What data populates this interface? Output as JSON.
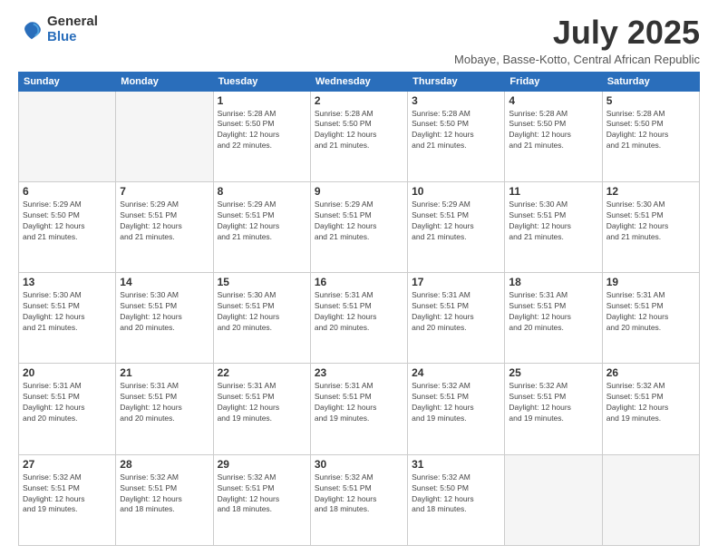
{
  "logo": {
    "general": "General",
    "blue": "Blue"
  },
  "title": "July 2025",
  "location": "Mobaye, Basse-Kotto, Central African Republic",
  "days_of_week": [
    "Sunday",
    "Monday",
    "Tuesday",
    "Wednesday",
    "Thursday",
    "Friday",
    "Saturday"
  ],
  "weeks": [
    [
      {
        "day": "",
        "info": ""
      },
      {
        "day": "",
        "info": ""
      },
      {
        "day": "1",
        "info": "Sunrise: 5:28 AM\nSunset: 5:50 PM\nDaylight: 12 hours\nand 22 minutes."
      },
      {
        "day": "2",
        "info": "Sunrise: 5:28 AM\nSunset: 5:50 PM\nDaylight: 12 hours\nand 21 minutes."
      },
      {
        "day": "3",
        "info": "Sunrise: 5:28 AM\nSunset: 5:50 PM\nDaylight: 12 hours\nand 21 minutes."
      },
      {
        "day": "4",
        "info": "Sunrise: 5:28 AM\nSunset: 5:50 PM\nDaylight: 12 hours\nand 21 minutes."
      },
      {
        "day": "5",
        "info": "Sunrise: 5:28 AM\nSunset: 5:50 PM\nDaylight: 12 hours\nand 21 minutes."
      }
    ],
    [
      {
        "day": "6",
        "info": "Sunrise: 5:29 AM\nSunset: 5:50 PM\nDaylight: 12 hours\nand 21 minutes."
      },
      {
        "day": "7",
        "info": "Sunrise: 5:29 AM\nSunset: 5:51 PM\nDaylight: 12 hours\nand 21 minutes."
      },
      {
        "day": "8",
        "info": "Sunrise: 5:29 AM\nSunset: 5:51 PM\nDaylight: 12 hours\nand 21 minutes."
      },
      {
        "day": "9",
        "info": "Sunrise: 5:29 AM\nSunset: 5:51 PM\nDaylight: 12 hours\nand 21 minutes."
      },
      {
        "day": "10",
        "info": "Sunrise: 5:29 AM\nSunset: 5:51 PM\nDaylight: 12 hours\nand 21 minutes."
      },
      {
        "day": "11",
        "info": "Sunrise: 5:30 AM\nSunset: 5:51 PM\nDaylight: 12 hours\nand 21 minutes."
      },
      {
        "day": "12",
        "info": "Sunrise: 5:30 AM\nSunset: 5:51 PM\nDaylight: 12 hours\nand 21 minutes."
      }
    ],
    [
      {
        "day": "13",
        "info": "Sunrise: 5:30 AM\nSunset: 5:51 PM\nDaylight: 12 hours\nand 21 minutes."
      },
      {
        "day": "14",
        "info": "Sunrise: 5:30 AM\nSunset: 5:51 PM\nDaylight: 12 hours\nand 20 minutes."
      },
      {
        "day": "15",
        "info": "Sunrise: 5:30 AM\nSunset: 5:51 PM\nDaylight: 12 hours\nand 20 minutes."
      },
      {
        "day": "16",
        "info": "Sunrise: 5:31 AM\nSunset: 5:51 PM\nDaylight: 12 hours\nand 20 minutes."
      },
      {
        "day": "17",
        "info": "Sunrise: 5:31 AM\nSunset: 5:51 PM\nDaylight: 12 hours\nand 20 minutes."
      },
      {
        "day": "18",
        "info": "Sunrise: 5:31 AM\nSunset: 5:51 PM\nDaylight: 12 hours\nand 20 minutes."
      },
      {
        "day": "19",
        "info": "Sunrise: 5:31 AM\nSunset: 5:51 PM\nDaylight: 12 hours\nand 20 minutes."
      }
    ],
    [
      {
        "day": "20",
        "info": "Sunrise: 5:31 AM\nSunset: 5:51 PM\nDaylight: 12 hours\nand 20 minutes."
      },
      {
        "day": "21",
        "info": "Sunrise: 5:31 AM\nSunset: 5:51 PM\nDaylight: 12 hours\nand 20 minutes."
      },
      {
        "day": "22",
        "info": "Sunrise: 5:31 AM\nSunset: 5:51 PM\nDaylight: 12 hours\nand 19 minutes."
      },
      {
        "day": "23",
        "info": "Sunrise: 5:31 AM\nSunset: 5:51 PM\nDaylight: 12 hours\nand 19 minutes."
      },
      {
        "day": "24",
        "info": "Sunrise: 5:32 AM\nSunset: 5:51 PM\nDaylight: 12 hours\nand 19 minutes."
      },
      {
        "day": "25",
        "info": "Sunrise: 5:32 AM\nSunset: 5:51 PM\nDaylight: 12 hours\nand 19 minutes."
      },
      {
        "day": "26",
        "info": "Sunrise: 5:32 AM\nSunset: 5:51 PM\nDaylight: 12 hours\nand 19 minutes."
      }
    ],
    [
      {
        "day": "27",
        "info": "Sunrise: 5:32 AM\nSunset: 5:51 PM\nDaylight: 12 hours\nand 19 minutes."
      },
      {
        "day": "28",
        "info": "Sunrise: 5:32 AM\nSunset: 5:51 PM\nDaylight: 12 hours\nand 18 minutes."
      },
      {
        "day": "29",
        "info": "Sunrise: 5:32 AM\nSunset: 5:51 PM\nDaylight: 12 hours\nand 18 minutes."
      },
      {
        "day": "30",
        "info": "Sunrise: 5:32 AM\nSunset: 5:51 PM\nDaylight: 12 hours\nand 18 minutes."
      },
      {
        "day": "31",
        "info": "Sunrise: 5:32 AM\nSunset: 5:50 PM\nDaylight: 12 hours\nand 18 minutes."
      },
      {
        "day": "",
        "info": ""
      },
      {
        "day": "",
        "info": ""
      }
    ]
  ]
}
